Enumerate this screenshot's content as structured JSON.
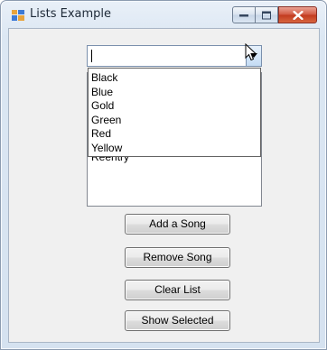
{
  "window": {
    "title": "Lists Example"
  },
  "icons": {
    "app": "app-window-icon",
    "minimize": "minimize-icon",
    "maximize": "maximize-icon",
    "close": "close-icon",
    "dropdown": "chevron-down-icon",
    "cursor": "mouse-pointer-icon"
  },
  "combo": {
    "value": ""
  },
  "dropdown": {
    "options": [
      "Black",
      "Blue",
      "Gold",
      "Green",
      "Red",
      "Yellow"
    ]
  },
  "listbox": {
    "items": [
      "Reentry"
    ]
  },
  "buttons": {
    "add": "Add a Song",
    "remove": "Remove Song",
    "clear": "Clear List",
    "show": "Show Selected"
  },
  "colors": {
    "close_button": "#c2391e",
    "title_text": "#1e2a38",
    "client_background": "#f0f0f0"
  }
}
